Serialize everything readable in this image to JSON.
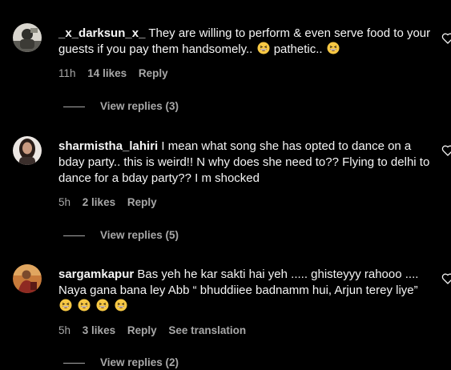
{
  "comments": [
    {
      "username": "_x_darksun_x_",
      "text": "They are willing to perform & even serve food to your guests if you pay them handsomely..",
      "text_mid": "pathetic..",
      "time": "11h",
      "likes": "14 likes",
      "reply": "Reply",
      "view_replies": "View replies (3)"
    },
    {
      "username": "sharmistha_lahiri",
      "text": "I mean what song she has opted to dance on a bday party.. this is weird!! N why does she need to?? Flying to delhi to dance for a bday party?? I m shocked",
      "time": "5h",
      "likes": "2 likes",
      "reply": "Reply",
      "view_replies": "View replies (5)"
    },
    {
      "username": "sargamkapur",
      "text": "Bas yeh he kar sakti hai yeh ..... ghisteyyy rahooo .... Naya gana bana ley Abb “ bhuddiiee badnamm hui, Arjun terey liye”",
      "time": "5h",
      "likes": "3 likes",
      "reply": "Reply",
      "translate": "See translation",
      "view_replies": "View replies (2)"
    }
  ],
  "icons": {
    "heart": "heart-outline-icon",
    "emoji": "grinning-squinting-face-emoji"
  },
  "colors": {
    "background": "#000000",
    "primary_text": "#f5f5f5",
    "secondary_text": "#a8a8a8",
    "emoji_face": "#f7c844"
  }
}
